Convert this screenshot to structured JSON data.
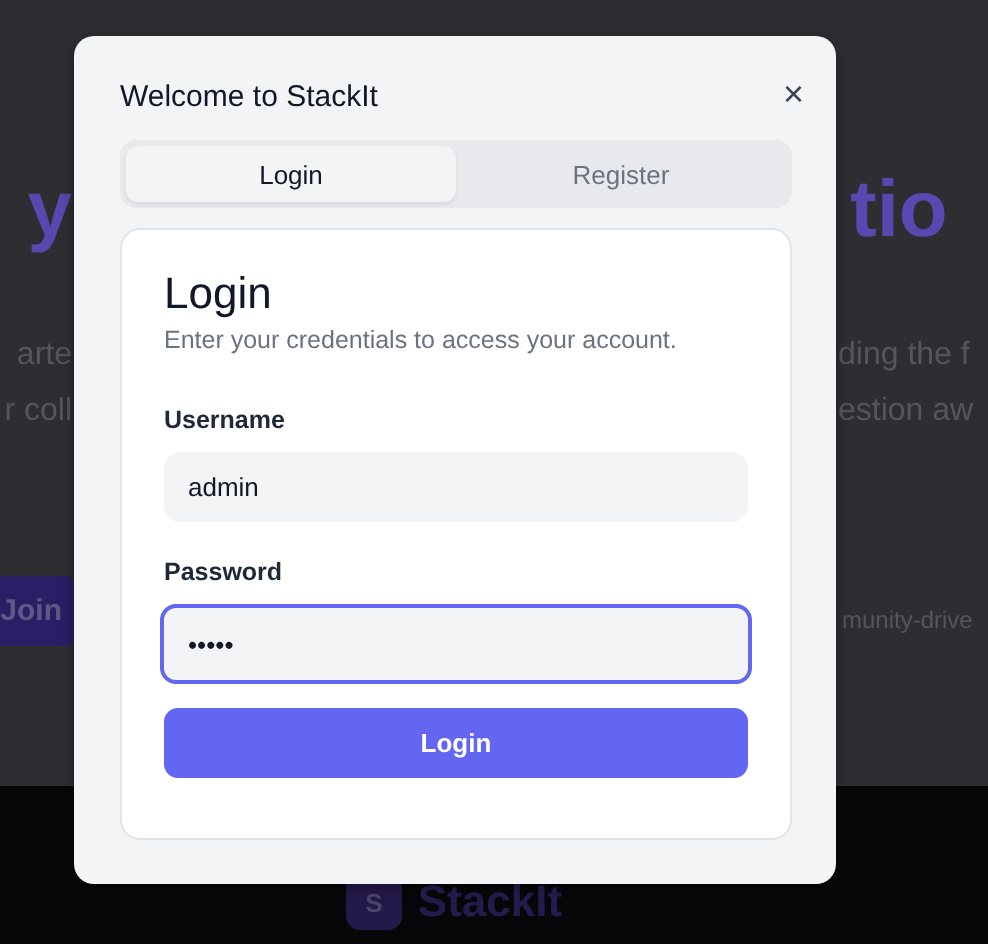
{
  "background": {
    "heading_left": "y",
    "heading_right": "tio",
    "text_left": [
      "arte",
      "r coll"
    ],
    "text_right": [
      "ding the f",
      "estion aw"
    ],
    "join_button": "Join",
    "tagline_right": "munity-drive",
    "footer_logo_letter": "S",
    "footer_brand": "StackIt"
  },
  "dialog": {
    "title": "Welcome to StackIt",
    "close": "×",
    "tabs": [
      {
        "label": "Login",
        "selected": true
      },
      {
        "label": "Register",
        "selected": false
      }
    ],
    "card": {
      "title": "Login",
      "subtitle": "Enter your credentials to access your account.",
      "fields": [
        {
          "label": "Username",
          "value": "admin",
          "focused": false
        },
        {
          "label": "Password",
          "value": "•••••",
          "focused": true
        }
      ],
      "submit": "Login"
    }
  }
}
